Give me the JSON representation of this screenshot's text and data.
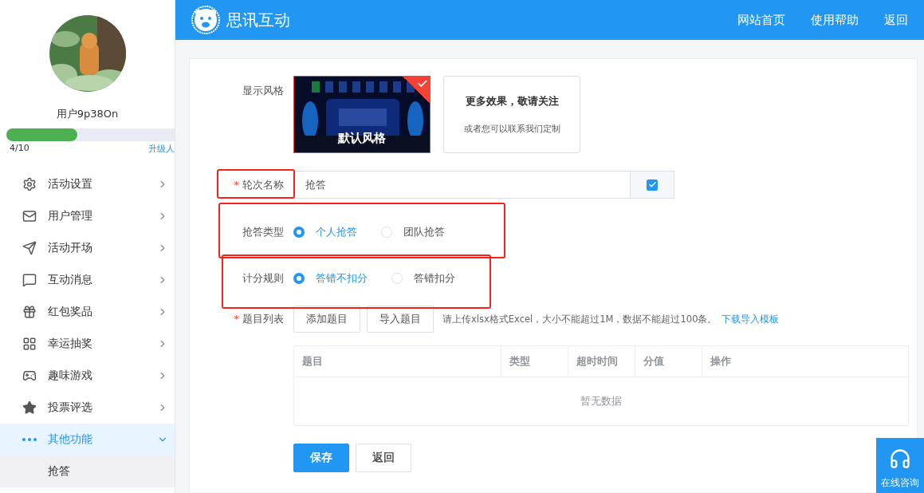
{
  "header": {
    "brand": "思讯互动",
    "links": [
      "网站首页",
      "使用帮助",
      "返回"
    ]
  },
  "profile": {
    "username": "用户9p38On",
    "quota": {
      "level": 0.42,
      "count": "4/10",
      "upgrade": "升级人"
    }
  },
  "sidebar": {
    "items": [
      {
        "label": "活动设置",
        "expanded": false,
        "selected": false
      },
      {
        "label": "用户管理",
        "expanded": false,
        "selected": false
      },
      {
        "label": "活动开场",
        "expanded": false,
        "selected": false
      },
      {
        "label": "互动消息",
        "expanded": false,
        "selected": false
      },
      {
        "label": "红包奖品",
        "expanded": false,
        "selected": false
      },
      {
        "label": "幸运抽奖",
        "expanded": false,
        "selected": false
      },
      {
        "label": "趣味游戏",
        "expanded": false,
        "selected": false
      },
      {
        "label": "投票评选",
        "expanded": false,
        "selected": false
      },
      {
        "label": "其他功能",
        "expanded": true,
        "selected": true,
        "children": [
          {
            "label": "抢答",
            "selected": false
          }
        ]
      }
    ]
  },
  "form": {
    "style": {
      "label": "显示风格",
      "options": [
        {
          "kind": "theme",
          "caption": "默认风格",
          "selected": true
        },
        {
          "kind": "more",
          "title": "更多效果，敬请关注",
          "subtitle": "或者您可以联系我们定制"
        }
      ]
    },
    "fields": [
      {
        "kind": "text",
        "label": "轮次名称",
        "required_mark": "*",
        "highlighted": true,
        "value": "抢答",
        "checked": true
      },
      {
        "kind": "radio",
        "label": "抢答类型",
        "highlighted": true,
        "options": [
          {
            "label": "个人抢答",
            "selected": true
          },
          {
            "label": "团队抢答",
            "selected": false
          }
        ]
      },
      {
        "kind": "radio",
        "label": "计分规则",
        "highlighted": true,
        "options": [
          {
            "label": "答错不扣分",
            "selected": true
          },
          {
            "label": "答错扣分",
            "selected": false
          }
        ]
      }
    ],
    "questions": {
      "label": "题目列表",
      "required_mark": "*",
      "buttons": [
        "添加题目",
        "导入题目"
      ],
      "hint": "请上传xlsx格式Excel，大小不能超过1M，数据不能超过100条。",
      "link": "下载导入模板",
      "table": {
        "columns": [
          "题目",
          "类型",
          "超时时间",
          "分值",
          "操作"
        ],
        "empty": "暂无数据"
      }
    },
    "actions": [
      {
        "label": "保存",
        "kind": "primary"
      },
      {
        "label": "返回",
        "kind": "default"
      }
    ]
  },
  "support": {
    "label": "在线咨询"
  }
}
